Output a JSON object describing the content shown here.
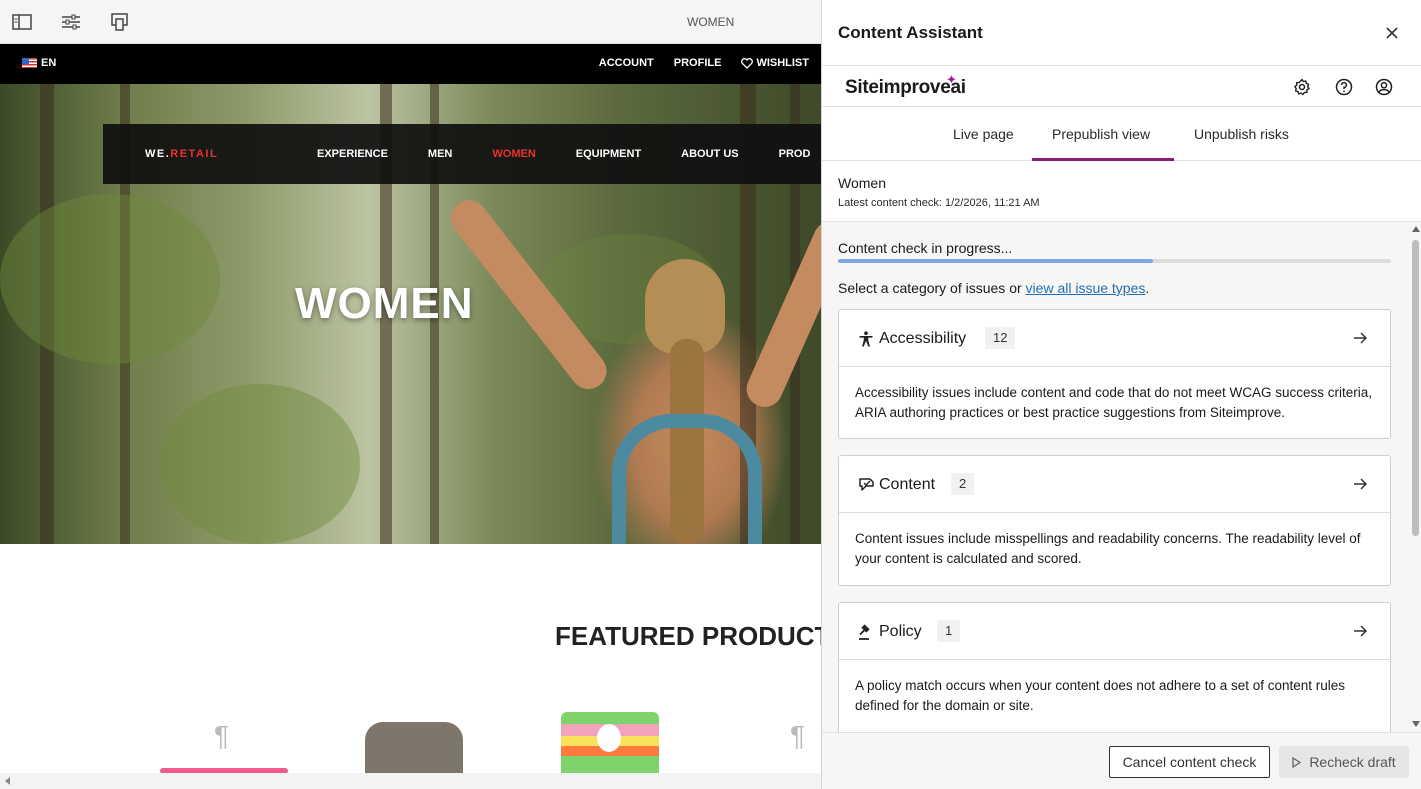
{
  "editor": {
    "page_name": "WOMEN",
    "icons": [
      "panel-toggle-icon",
      "properties-icon",
      "emulator-icon"
    ]
  },
  "site": {
    "language": "EN",
    "top_links": [
      "ACCOUNT",
      "PROFILE",
      "WISHLIST"
    ],
    "brand_left": "WE.",
    "brand_right": "RETAIL",
    "nav": [
      "EXPERIENCE",
      "MEN",
      "WOMEN",
      "EQUIPMENT",
      "ABOUT US",
      "PROD"
    ],
    "active_nav": "WOMEN",
    "hero_title": "WOMEN",
    "featured_heading": "FEATURED PRODUCTS"
  },
  "assistant": {
    "title": "Content Assistant",
    "logo": "Siteimprove",
    "logo_suffix": "ai",
    "tabs": [
      "Live page",
      "Prepublish view",
      "Unpublish risks"
    ],
    "active_tab": "Prepublish view",
    "page_title": "Women",
    "latest_check": "Latest content check: 1/2/2026, 11:21 AM",
    "progress_label": "Content check in progress...",
    "progress": 0.57,
    "select_prefix": "Select a category of issues or ",
    "select_link": "view all issue types",
    "select_suffix": ".",
    "categories": [
      {
        "name": "Accessibility",
        "count": "12",
        "icon": "accessibility-icon",
        "description": "Accessibility issues include content and code that do not meet WCAG success criteria, ARIA authoring practices or best practice suggestions from Siteimprove."
      },
      {
        "name": "Content",
        "count": "2",
        "icon": "content-icon",
        "description": "Content issues include misspellings and readability concerns. The readability level of your content is calculated and scored."
      },
      {
        "name": "Policy",
        "count": "1",
        "icon": "gavel-icon",
        "description": "A policy match occurs when your content does not adhere to a set of content rules defined for the domain or site."
      }
    ],
    "buttons": {
      "cancel": "Cancel content check",
      "recheck": "Recheck draft"
    },
    "colors": {
      "accent": "#8a1c7c",
      "progress": "#7fa8e8",
      "link": "#1f6fb8"
    }
  }
}
